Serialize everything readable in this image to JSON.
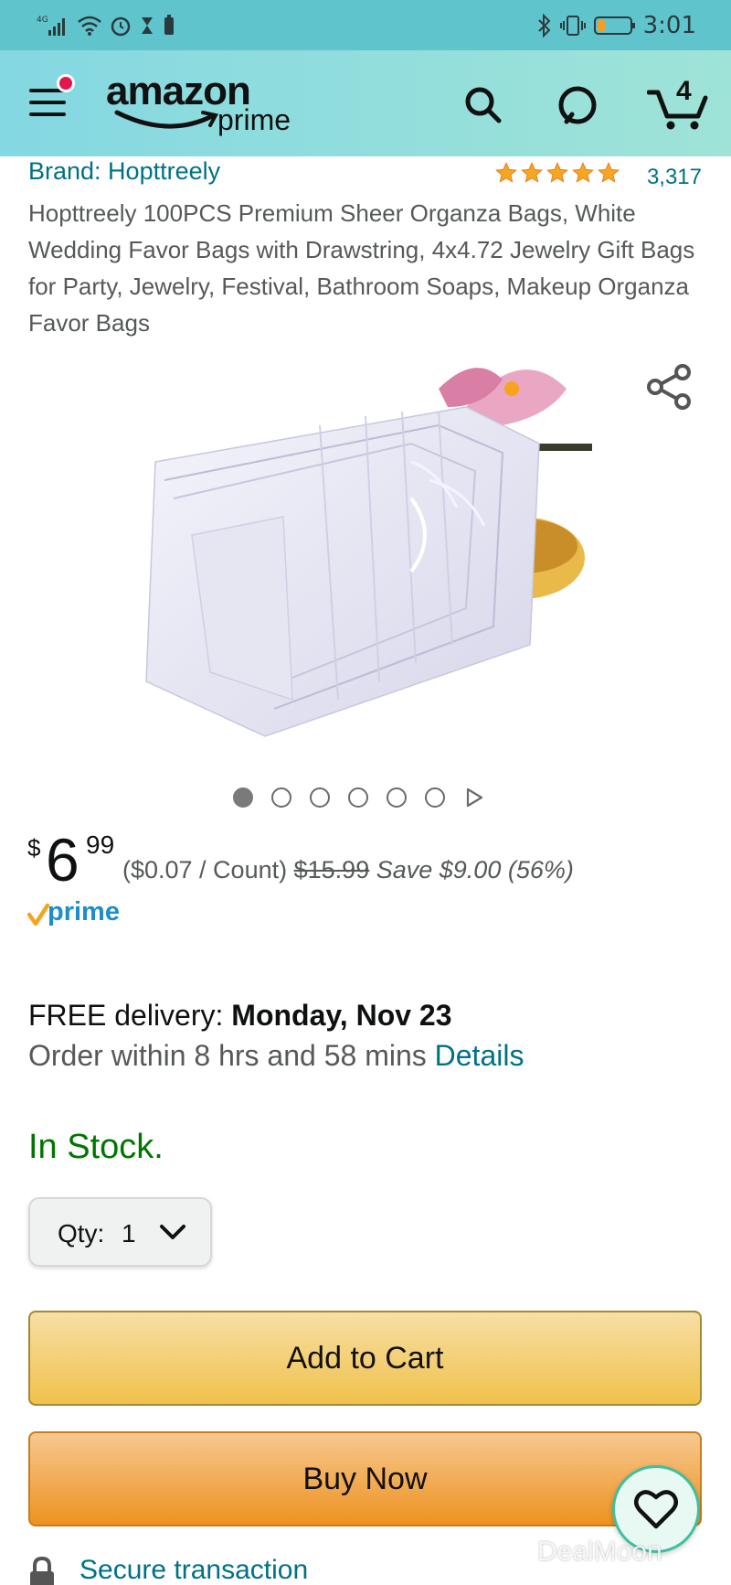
{
  "status_bar": {
    "network": "4G",
    "time": "3:01",
    "icons": [
      "signal-icon",
      "wifi-icon",
      "alarm-icon",
      "hourglass-icon",
      "battery-small-icon",
      "bluetooth-icon",
      "vibrate-icon",
      "battery-icon"
    ]
  },
  "header": {
    "logo_word": "amazon",
    "logo_sub": "prime",
    "cart_count": "4",
    "icons": [
      "menu-icon",
      "search-icon",
      "alexa-icon",
      "cart-icon"
    ]
  },
  "product": {
    "brand": "Brand: Hopttreely",
    "rating_stars": 5,
    "rating_count": "3,317",
    "title": "Hopttreely 100PCS Premium Sheer Organza Bags, White Wedding Favor Bags with Drawstring, 4x4.72 Jewelry Gift Bags for Party, Jewelry, Festival, Bathroom Soaps, Makeup Organza Favor Bags",
    "image_count": 6,
    "active_image_index": 0
  },
  "price": {
    "symbol": "$",
    "whole": "6",
    "fraction": "99",
    "unit_price": "($0.07 / Count)",
    "list_price": "$15.99",
    "savings": "Save $9.00 (56%)",
    "prime_label": "prime"
  },
  "delivery": {
    "prefix": "FREE delivery: ",
    "date": "Monday, Nov 23",
    "order_within": "Order within 8 hrs and 58 mins ",
    "details_link": "Details"
  },
  "stock": "In Stock.",
  "quantity": {
    "label": "Qty:",
    "value": "1"
  },
  "buttons": {
    "add_to_cart": "Add to Cart",
    "buy_now": "Buy Now"
  },
  "secure": "Secure transaction",
  "watermark": "DealMoon",
  "colors": {
    "link": "#007185",
    "in_stock": "#007600",
    "cart_button": "#f0c14b",
    "buy_button": "#ed9220",
    "header": "#84d8e2"
  }
}
